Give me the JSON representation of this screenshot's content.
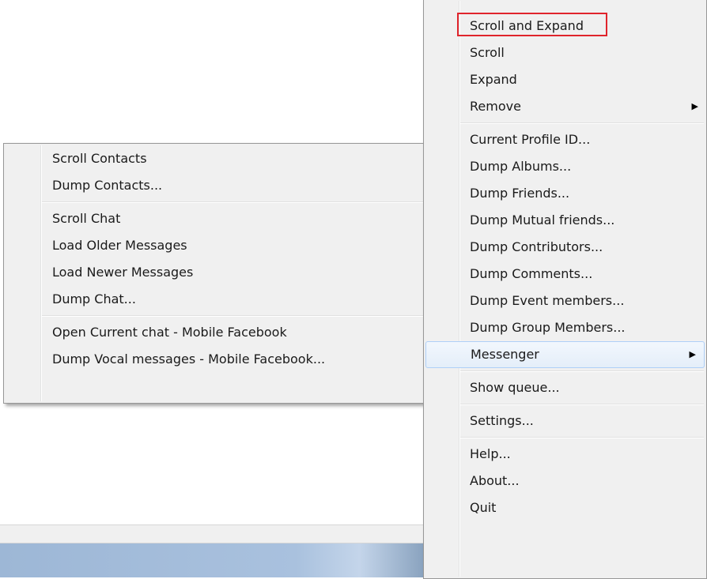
{
  "submenu": {
    "items": [
      {
        "label": "Scroll Contacts"
      },
      {
        "label": "Dump Contacts..."
      },
      {
        "label": "Scroll Chat"
      },
      {
        "label": "Load Older Messages"
      },
      {
        "label": "Load Newer Messages"
      },
      {
        "label": "Dump Chat..."
      },
      {
        "label": "Open Current chat - Mobile Facebook"
      },
      {
        "label": "Dump Vocal messages - Mobile Facebook..."
      }
    ]
  },
  "main_menu": {
    "items": [
      {
        "label": "Scroll and Expand"
      },
      {
        "label": "Scroll"
      },
      {
        "label": "Expand"
      },
      {
        "label": "Remove"
      },
      {
        "label": "Current Profile ID..."
      },
      {
        "label": "Dump Albums..."
      },
      {
        "label": "Dump Friends..."
      },
      {
        "label": "Dump Mutual friends..."
      },
      {
        "label": "Dump Contributors..."
      },
      {
        "label": "Dump Comments..."
      },
      {
        "label": "Dump Event members..."
      },
      {
        "label": "Dump Group Members..."
      },
      {
        "label": "Messenger"
      },
      {
        "label": "Show queue..."
      },
      {
        "label": "Settings..."
      },
      {
        "label": "Help..."
      },
      {
        "label": "About..."
      },
      {
        "label": "Quit"
      }
    ]
  },
  "colors": {
    "menu_bg": "#f0f0f0",
    "highlight_border": "#aecff7",
    "annotation_red": "#e0242c"
  },
  "icons": {
    "submenu_arrow": "submenu-arrow-icon"
  }
}
